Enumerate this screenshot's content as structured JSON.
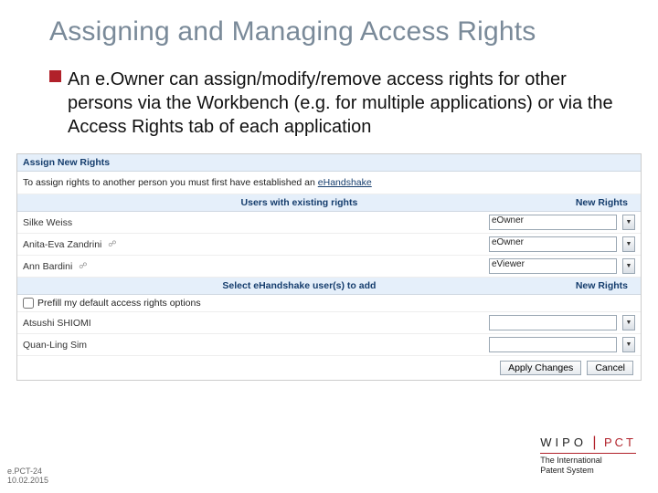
{
  "title": "Assigning and Managing Access Rights",
  "bullet": "An e.Owner can assign/modify/remove access rights for other persons via the Workbench (e.g. for multiple applications) or via the Access Rights tab of each application",
  "shot": {
    "assign_header": "Assign New Rights",
    "assign_info_prefix": "To assign rights to another person you must first have established an ",
    "assign_info_link": "eHandshake",
    "users_header_left": "Users with existing rights",
    "users_header_right": "New Rights",
    "users": [
      {
        "name": "Silke Weiss",
        "role": "eOwner"
      },
      {
        "name": "Anita-Eva Zandrini",
        "role": "eOwner"
      },
      {
        "name": "Ann Bardini",
        "role": "eViewer"
      }
    ],
    "select_header_left": "Select eHandshake user(s) to add",
    "select_header_right": "New Rights",
    "prefill_label": "Prefill my default access rights options",
    "add_users": [
      {
        "name": "Atsushi SHIOMI"
      },
      {
        "name": "Quan-Ling Sim"
      }
    ],
    "apply_btn": "Apply Changes",
    "cancel_btn": "Cancel"
  },
  "footer": {
    "wipo": "WIPO",
    "pct": "PCT",
    "tagline1": "The International",
    "tagline2": "Patent System",
    "code": "e.PCT-24",
    "date": "10.02.2015"
  }
}
